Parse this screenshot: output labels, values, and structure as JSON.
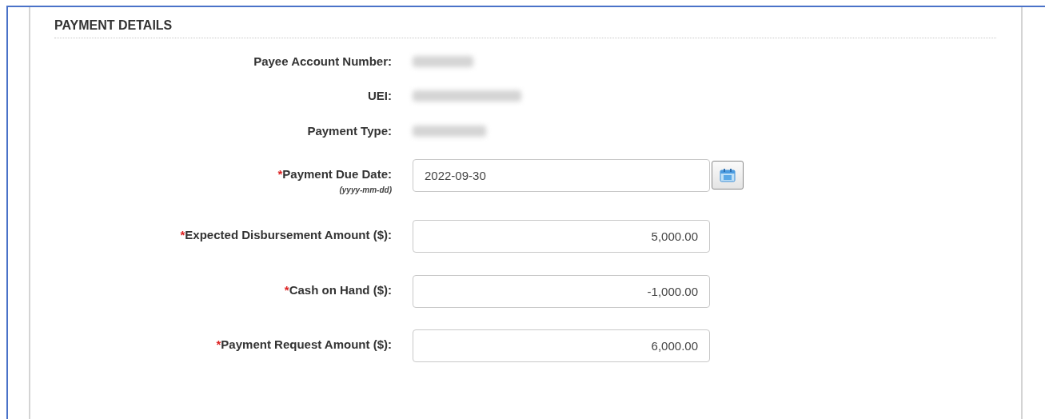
{
  "section": {
    "title": "PAYMENT DETAILS"
  },
  "fields": [
    {
      "kind": "redacted",
      "label": "Payee Account Number:",
      "required": false
    },
    {
      "kind": "redacted",
      "label": "UEI:",
      "required": false
    },
    {
      "kind": "redacted",
      "label": "Payment Type:",
      "required": false
    },
    {
      "kind": "date",
      "label": "Payment Due Date:",
      "hint": "(yyyy-mm-dd)",
      "required": true,
      "value": "2022-09-30"
    },
    {
      "kind": "amount",
      "label": "Expected Disbursement Amount ($):",
      "required": true,
      "value": "5,000.00"
    },
    {
      "kind": "amount",
      "label": "Cash on Hand ($):",
      "required": true,
      "value": "-1,000.00"
    },
    {
      "kind": "amount",
      "label": "Payment Request Amount ($):",
      "required": true,
      "value": "6,000.00"
    }
  ],
  "required_mark": "*"
}
